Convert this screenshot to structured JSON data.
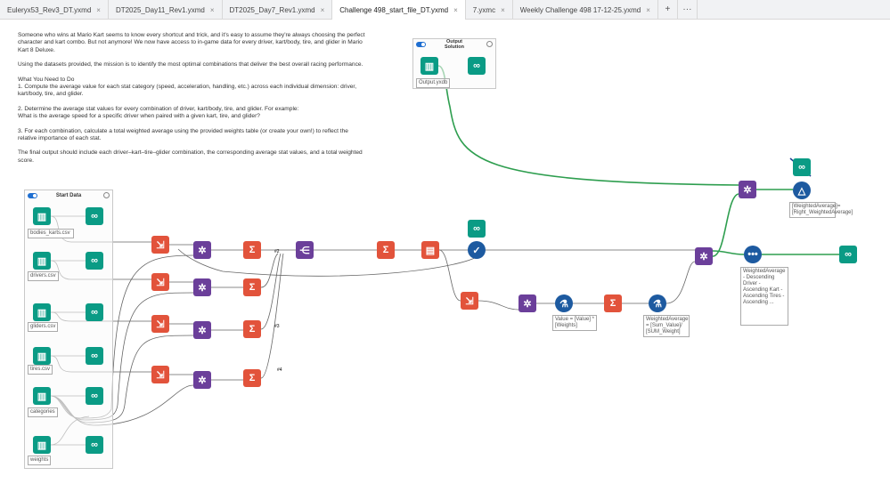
{
  "tabs": [
    {
      "label": "Euleryx53_Rev3_DT.yxmd",
      "active": false
    },
    {
      "label": "DT2025_Day11_Rev1.yxmd",
      "active": false
    },
    {
      "label": "DT2025_Day7_Rev1.yxmd",
      "active": false
    },
    {
      "label": "Challenge 498_start_file_DT.yxmd",
      "active": true
    },
    {
      "label": "7.yxmc",
      "active": false
    },
    {
      "label": "Weekly Challenge 498 17-12-25.yxmd",
      "active": false
    }
  ],
  "tab_add": "+",
  "tab_more": "···",
  "tab_close": "×",
  "comment": [
    "Someone who wins at Mario Kart seems to know every shortcut and trick, and it's easy to assume they're always choosing the perfect character and kart combo. But not anymore! We now have access to in-game data for every driver, kart/body, tire, and glider in Mario Kart 8 Deluxe.",
    "Using the datasets provided, the mission is to identify the most optimal combinations that deliver the best overall racing performance.",
    "What You Need to Do\n1. Compute the average value for each stat category (speed, acceleration, handling, etc.) across each individual dimension: driver, kart/body, tire, and glider.",
    "2. Determine the average stat values for every combination of driver, kart/body, tire, and glider. For example:\nWhat is the average speed for a specific driver when paired with a given kart, tire, and glider?",
    "3. For each combination, calculate a total weighted average using the provided weights table (or create your own!) to reflect the relative importance of each stat.",
    "The final output should include each driver–kart–tire–glider combination, the corresponding average stat values, and a total weighted score."
  ],
  "containers": {
    "start": "Start Data",
    "output": "Output Solution"
  },
  "inputs": [
    "bodies_karts.csv",
    "drivers.csv",
    "gliders.csv",
    "tires.csv",
    "categories",
    "weights"
  ],
  "output_file": "Output.yxdb",
  "annotations": {
    "formula1": "Value = [Value] *[Weights]",
    "formula2": "WeightedAverage = [Sum_Value]/ [SUM_Weight]",
    "filter": "[WeightedAverage]= [Right_WeightedAverage]",
    "sort": "WeightedAverage - Descending Driver - Ascending Kart - Ascending Tires - Ascending ..."
  },
  "union_labels": [
    "#2",
    "#3",
    "#4"
  ],
  "colors": {
    "input": "#0a9b85",
    "transform": "#e2533b",
    "join": "#6b3f9a",
    "formula": "#1d5aa0",
    "wire_green": "#2e9e4f"
  }
}
